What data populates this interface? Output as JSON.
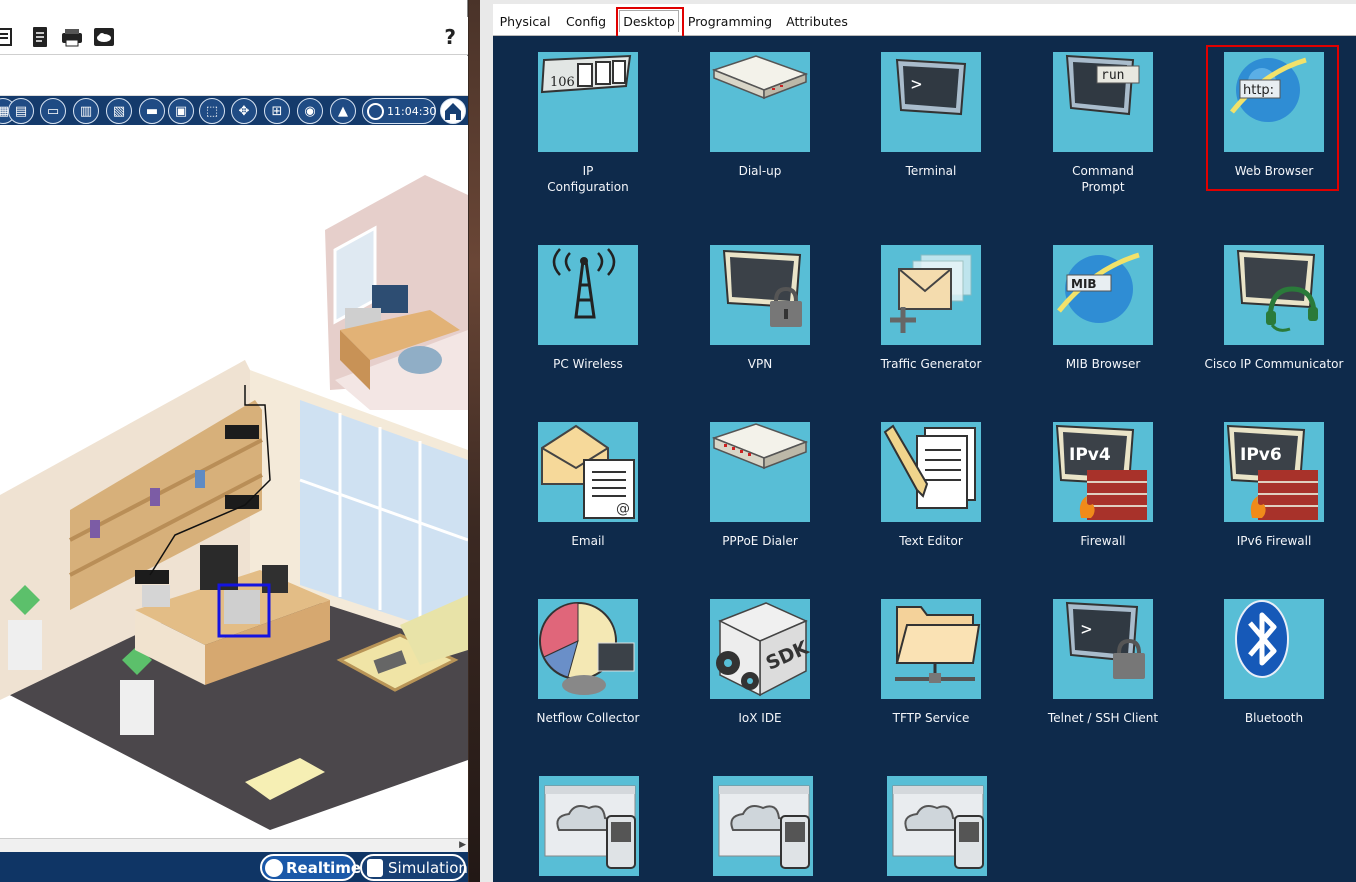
{
  "left_panel": {
    "help": "?",
    "clock": "11:04:30",
    "realtime": "Realtime",
    "simulation": "Simulation",
    "toolbar_icons": [
      "list-icon",
      "document-icon",
      "printer-icon",
      "cloud-drive-icon"
    ]
  },
  "tabs": [
    "Physical",
    "Config",
    "Desktop",
    "Programming",
    "Attributes"
  ],
  "active_tab": "Desktop",
  "apps": [
    {
      "label": "IP\nConfiguration",
      "icon": "ip-configuration-icon"
    },
    {
      "label": "Dial-up",
      "icon": "dial-up-modem-icon"
    },
    {
      "label": "Terminal",
      "icon": "terminal-icon"
    },
    {
      "label": "Command\nPrompt",
      "icon": "command-prompt-icon"
    },
    {
      "label": "Web Browser",
      "icon": "web-browser-icon"
    },
    {
      "label": "PC Wireless",
      "icon": "wireless-tower-icon"
    },
    {
      "label": "VPN",
      "icon": "vpn-lock-icon"
    },
    {
      "label": "Traffic Generator",
      "icon": "traffic-generator-icon"
    },
    {
      "label": "MIB Browser",
      "icon": "mib-browser-icon"
    },
    {
      "label": "Cisco IP Communicator",
      "icon": "ip-communicator-headset-icon"
    },
    {
      "label": "Email",
      "icon": "email-icon"
    },
    {
      "label": "PPPoE Dialer",
      "icon": "pppoe-dialer-icon"
    },
    {
      "label": "Text Editor",
      "icon": "text-editor-icon"
    },
    {
      "label": "Firewall",
      "icon": "ipv4-firewall-icon"
    },
    {
      "label": "IPv6 Firewall",
      "icon": "ipv6-firewall-icon"
    },
    {
      "label": "Netflow Collector",
      "icon": "netflow-collector-icon"
    },
    {
      "label": "IoX IDE",
      "icon": "iox-sdk-icon"
    },
    {
      "label": "TFTP Service",
      "icon": "tftp-folder-icon"
    },
    {
      "label": "Telnet / SSH Client",
      "icon": "telnet-ssh-icon"
    },
    {
      "label": "Bluetooth",
      "icon": "bluetooth-icon"
    },
    {
      "label": "",
      "icon": "iot-cloud-phone-icon"
    },
    {
      "label": "",
      "icon": "iot-cloud-phone-icon"
    },
    {
      "label": "",
      "icon": "iot-cloud-phone-icon"
    }
  ],
  "icon_text": {
    "ip_config_number": "106",
    "command_prompt": "run",
    "web_browser": "http:",
    "mib": "MIB",
    "ipv4": "IPv4",
    "ipv6": "IPv6",
    "sdk": "SDK",
    "prompt": ">"
  },
  "colors": {
    "desktop_bg": "#0e2a4b",
    "tile_bg": "#58bed6",
    "highlight": "#e00000",
    "nav_strip": "#143a6b"
  }
}
